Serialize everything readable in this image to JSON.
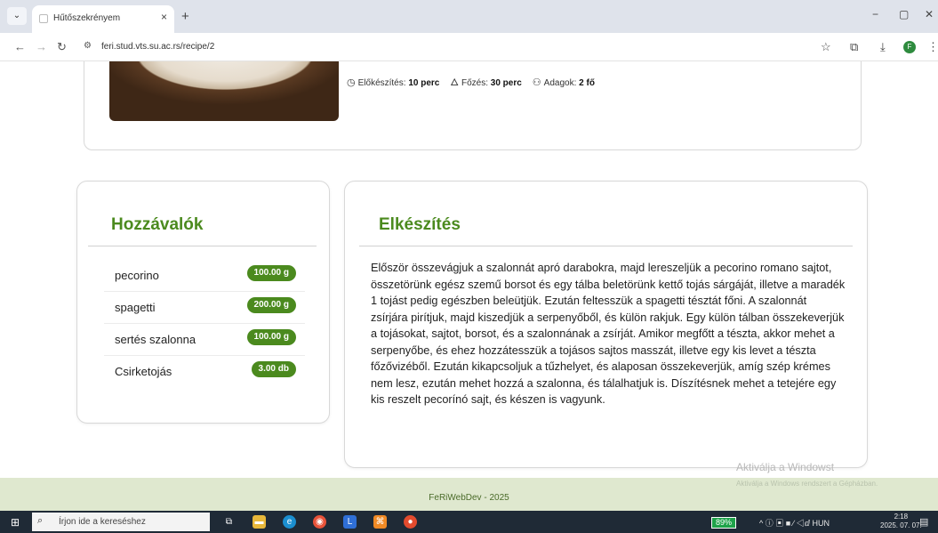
{
  "browser": {
    "tab_title": "Hűtőszekrényem",
    "tab_close": "×",
    "new_tab": "+",
    "url": "feri.stud.vts.su.ac.rs/recipe/2",
    "controls": {
      "minimize": "−",
      "maximize": "▢",
      "close": "✕"
    }
  },
  "recipe": {
    "meta": {
      "prep_label": "Előkészítés:",
      "prep_value": "10 perc",
      "cook_label": "Főzés:",
      "cook_value": "30 perc",
      "servings_label": "Adagok:",
      "servings_value": "2 fő"
    },
    "ingredients_title": "Hozzávalók",
    "ingredients": [
      {
        "name": "pecorino",
        "amount": "100.00 g"
      },
      {
        "name": "spagetti",
        "amount": "200.00 g"
      },
      {
        "name": "sertés szalonna",
        "amount": "100.00 g"
      },
      {
        "name": "Csirketojás",
        "amount": "3.00 db"
      }
    ],
    "preparation_title": "Elkészítés",
    "preparation_text": "Először összevágjuk a szalonnát apró darabokra, majd lereszeljük a pecorino romano sajtot, összetörünk egész szemű borsot és egy tálba beletörünk kettő tojás sárgáját, illetve a maradék 1 tojást pedig egészben beleütjük. Ezután feltesszük a spagetti tésztát főni. A szalonnát zsírjára pirítjuk, majd kiszedjük a serpenyőből, és külön rakjuk. Egy külön tálban összekeverjük a tojásokat, sajtot, borsot, és a szalonnának a zsírját. Amikor megfőtt a tészta, akkor mehet a serpenyőbe, és ehez hozzátesszük a tojásos sajtos masszát, illetve egy kis levet a tészta főzővizéből. Ezután kikapcsoljuk a tűzhelyet, és alaposan összekeverjük, amíg szép krémes nem lesz, ezután mehet hozzá a szalonna, és tálalhatjuk is. Díszítésnek mehet a tetejére egy kis reszelt pecorínó sajt, és készen is vagyunk."
  },
  "watermark": {
    "line1": "Aktiválja a Windowst",
    "line2": "Aktiválja a Windows rendszert a Gépházban."
  },
  "footer": {
    "text": "FeRiWebDev - 2025"
  },
  "taskbar": {
    "search_placeholder": "Írjon ide a kereséshez",
    "battery": "89%",
    "tray": "^ ⓘ ▣ ■ ∕ ◁ⅆ HUN",
    "time": "2:18",
    "date": "2025. 07. 07."
  },
  "colors": {
    "accent": "#4b8a1e",
    "footer_bg": "#dfe8cf",
    "taskbar_bg": "#1f2a36"
  }
}
